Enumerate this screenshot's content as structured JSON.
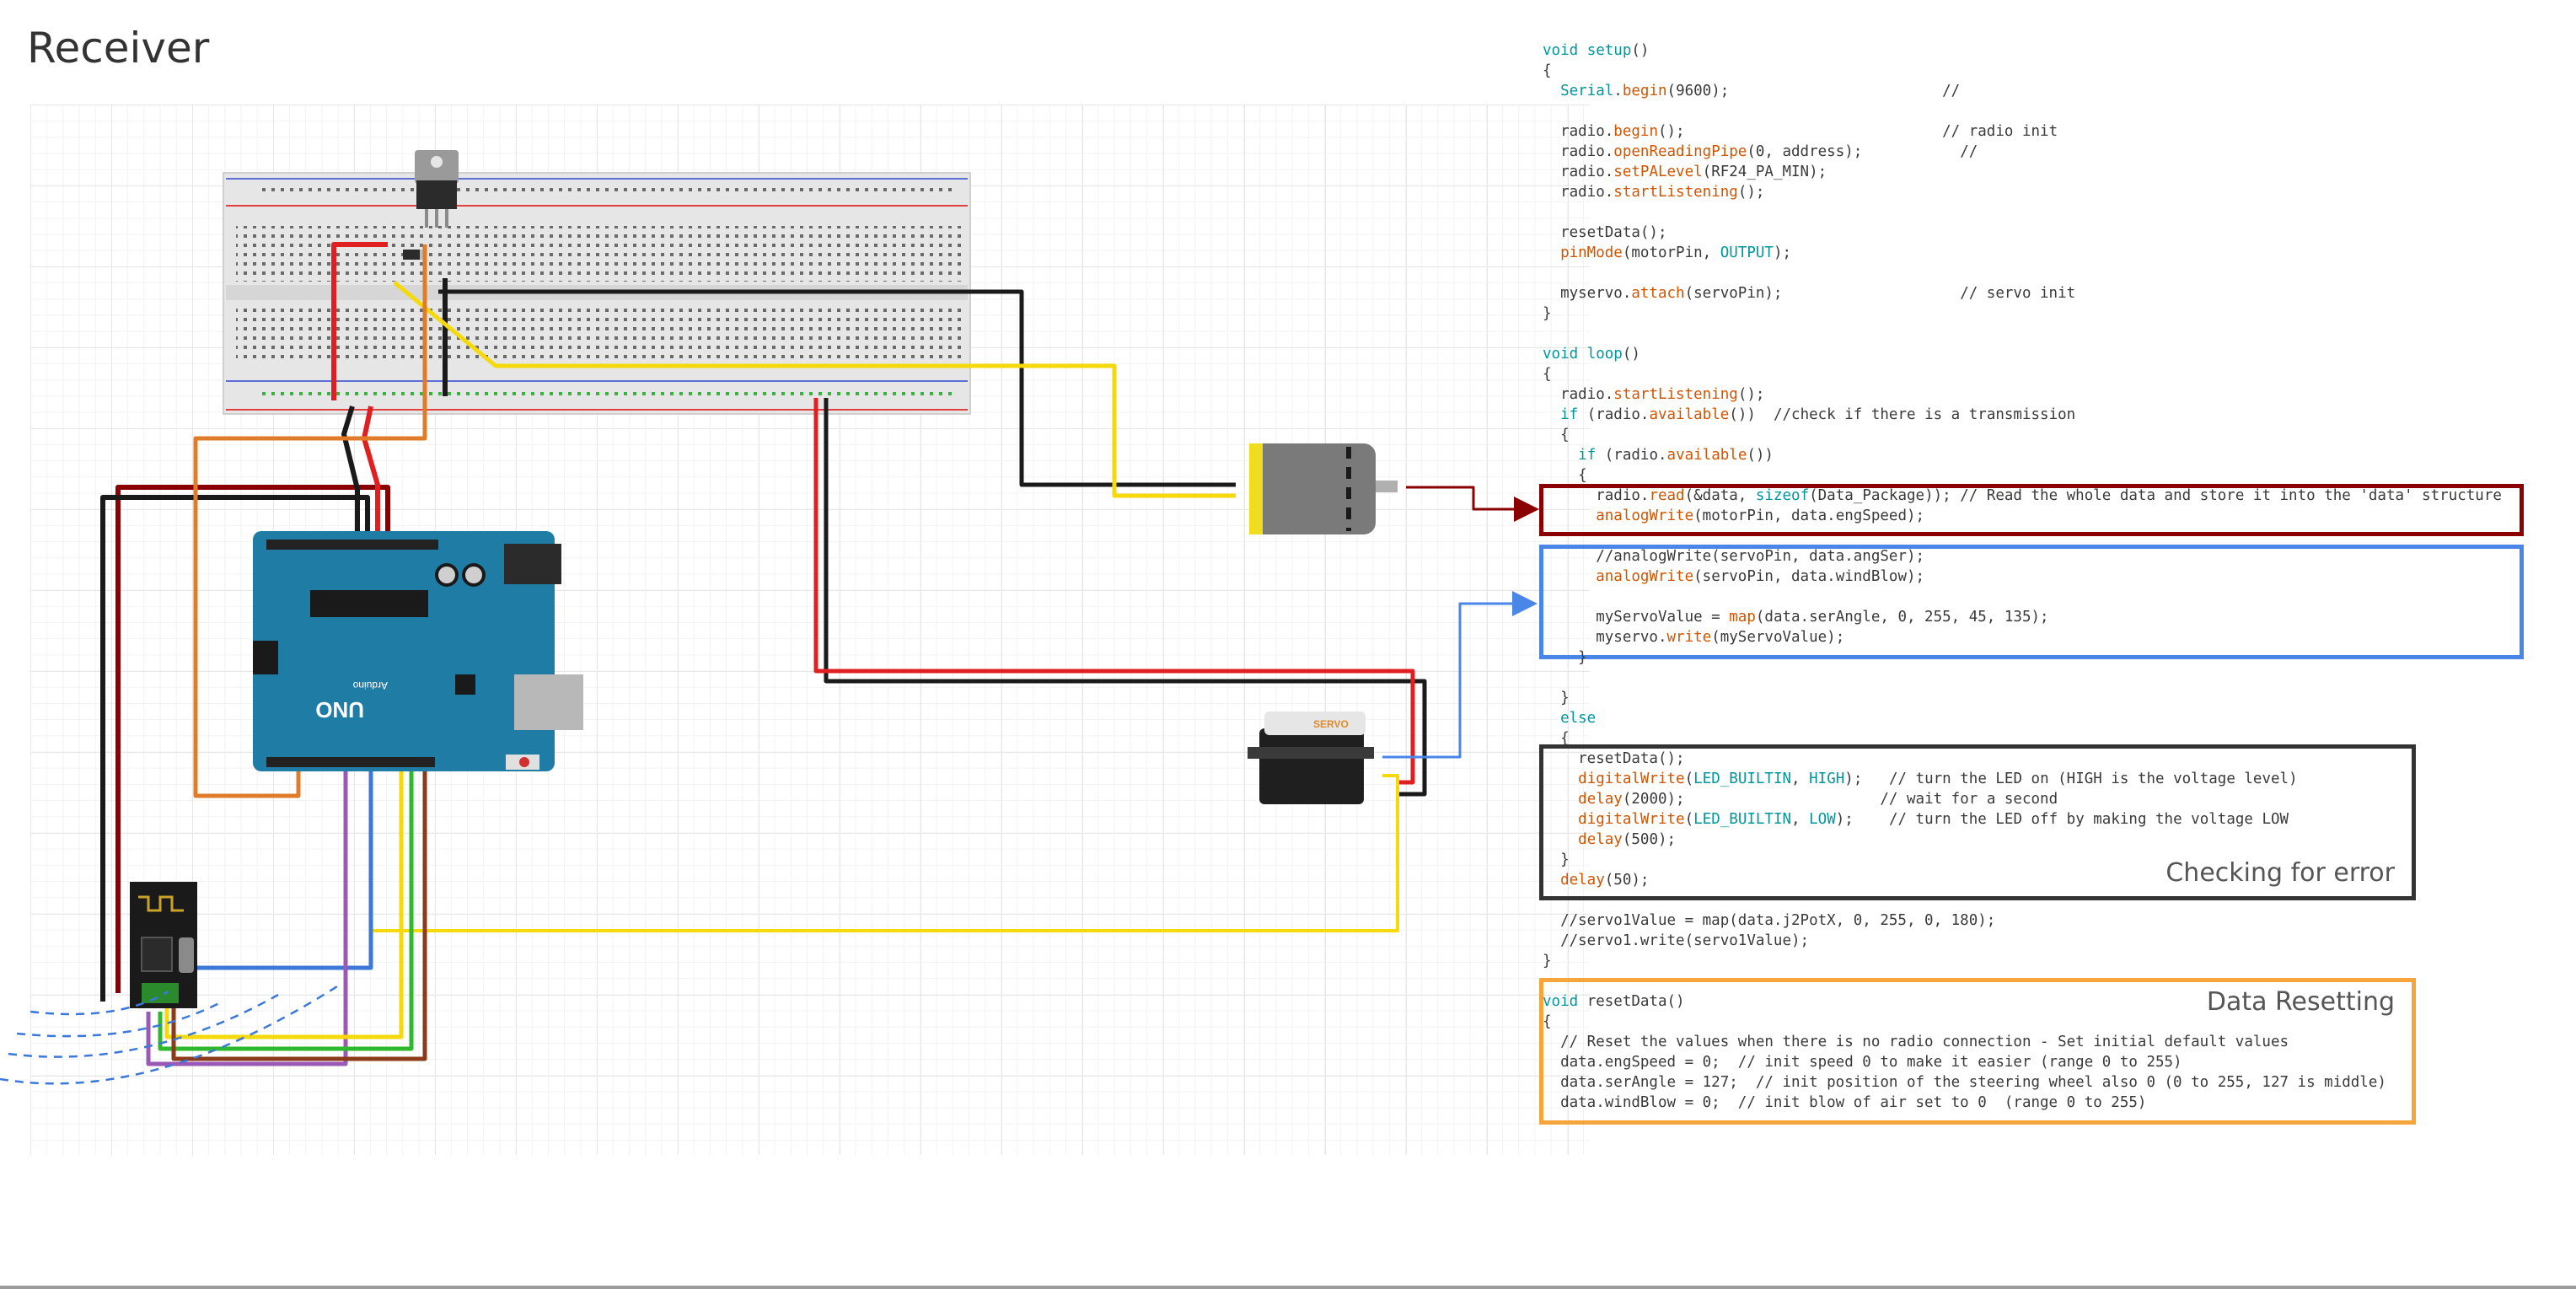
{
  "page_title": "Receiver",
  "colors": {
    "read_box": "#8b0000",
    "servo_box": "#4a86e8",
    "error_box": "#333333",
    "reset_box": "#f6a53c",
    "wire_red": "#e02020",
    "wire_black": "#1a1a1a",
    "wire_yellow": "#f5d90a",
    "wire_orange": "#e07b2a",
    "wire_blue": "#3b78d8",
    "wire_purple": "#9b59b6",
    "wire_green": "#2eb82e",
    "wire_brown": "#8b3a1a",
    "arduino_board": "#1f7ca5",
    "keyword_color": "#00979c",
    "function_color": "#d35400"
  },
  "components": {
    "arduino": {
      "model_label": "UNO",
      "brand_label": "Arduino"
    },
    "servo": {
      "label": "SERVO"
    },
    "breadboard": {},
    "voltage_regulator": {},
    "dc_motor": {},
    "nrf24_module": {}
  },
  "code_lines": [
    [
      [
        "kw",
        "void"
      ],
      [
        "t",
        " "
      ],
      [
        "kw",
        "setup"
      ],
      [
        "t",
        "()"
      ]
    ],
    [
      [
        "t",
        "{"
      ]
    ],
    [
      [
        "t",
        "  "
      ],
      [
        "kw",
        "Serial"
      ],
      [
        "t",
        "."
      ],
      [
        "fn",
        "begin"
      ],
      [
        "t",
        "(9600);                        //"
      ]
    ],
    [
      [
        "t",
        ""
      ]
    ],
    [
      [
        "t",
        "  radio."
      ],
      [
        "fn",
        "begin"
      ],
      [
        "t",
        "();                             // radio init"
      ]
    ],
    [
      [
        "t",
        "  radio."
      ],
      [
        "fn",
        "openReadingPipe"
      ],
      [
        "t",
        "(0, address);           //"
      ]
    ],
    [
      [
        "t",
        "  radio."
      ],
      [
        "fn",
        "setPALevel"
      ],
      [
        "t",
        "(RF24_PA_MIN);"
      ]
    ],
    [
      [
        "t",
        "  radio."
      ],
      [
        "fn",
        "startListening"
      ],
      [
        "t",
        "();"
      ]
    ],
    [
      [
        "t",
        ""
      ]
    ],
    [
      [
        "t",
        "  resetData();"
      ]
    ],
    [
      [
        "t",
        "  "
      ],
      [
        "fn",
        "pinMode"
      ],
      [
        "t",
        "(motorPin, "
      ],
      [
        "kw",
        "OUTPUT"
      ],
      [
        "t",
        ");"
      ]
    ],
    [
      [
        "t",
        ""
      ]
    ],
    [
      [
        "t",
        "  myservo."
      ],
      [
        "fn",
        "attach"
      ],
      [
        "t",
        "(servoPin);                    // servo init"
      ]
    ],
    [
      [
        "t",
        "}"
      ]
    ],
    [
      [
        "t",
        ""
      ]
    ],
    [
      [
        "kw",
        "void"
      ],
      [
        "t",
        " "
      ],
      [
        "kw",
        "loop"
      ],
      [
        "t",
        "()"
      ]
    ],
    [
      [
        "t",
        "{"
      ]
    ],
    [
      [
        "t",
        "  radio."
      ],
      [
        "fn",
        "startListening"
      ],
      [
        "t",
        "();"
      ]
    ],
    [
      [
        "t",
        "  "
      ],
      [
        "kw",
        "if"
      ],
      [
        "t",
        " (radio."
      ],
      [
        "fn",
        "available"
      ],
      [
        "t",
        "())  //check if there is a transmission"
      ]
    ],
    [
      [
        "t",
        "  {"
      ]
    ],
    [
      [
        "t",
        "    "
      ],
      [
        "kw",
        "if"
      ],
      [
        "t",
        " (radio."
      ],
      [
        "fn",
        "available"
      ],
      [
        "t",
        "())"
      ]
    ],
    [
      [
        "t",
        "    {"
      ]
    ],
    [
      [
        "t",
        "      radio."
      ],
      [
        "fn",
        "read"
      ],
      [
        "t",
        "(&data, "
      ],
      [
        "kw",
        "sizeof"
      ],
      [
        "t",
        "(Data_Package)); // Read the whole data and store it into the 'data' structure"
      ]
    ],
    [
      [
        "t",
        "      "
      ],
      [
        "fn",
        "analogWrite"
      ],
      [
        "t",
        "(motorPin, data.engSpeed);"
      ]
    ],
    [
      [
        "t",
        ""
      ]
    ],
    [
      [
        "t",
        "      //analogWrite(servoPin, data.angSer);"
      ]
    ],
    [
      [
        "t",
        "      "
      ],
      [
        "fn",
        "analogWrite"
      ],
      [
        "t",
        "(servoPin, data.windBlow);"
      ]
    ],
    [
      [
        "t",
        ""
      ]
    ],
    [
      [
        "t",
        "      myServoValue = "
      ],
      [
        "fn",
        "map"
      ],
      [
        "t",
        "(data.serAngle, 0, 255, 45, 135);"
      ]
    ],
    [
      [
        "t",
        "      myservo."
      ],
      [
        "fn",
        "write"
      ],
      [
        "t",
        "(myServoValue);"
      ]
    ],
    [
      [
        "t",
        "    }"
      ]
    ],
    [
      [
        "t",
        ""
      ]
    ],
    [
      [
        "t",
        "  }"
      ]
    ],
    [
      [
        "t",
        "  "
      ],
      [
        "kw",
        "else"
      ]
    ],
    [
      [
        "t",
        "  {"
      ]
    ],
    [
      [
        "t",
        "    resetData();"
      ]
    ],
    [
      [
        "t",
        "    "
      ],
      [
        "fn",
        "digitalWrite"
      ],
      [
        "t",
        "("
      ],
      [
        "kw",
        "LED_BUILTIN"
      ],
      [
        "t",
        ", "
      ],
      [
        "kw",
        "HIGH"
      ],
      [
        "t",
        ");   // turn the LED on (HIGH is the voltage level)"
      ]
    ],
    [
      [
        "t",
        "    "
      ],
      [
        "fn",
        "delay"
      ],
      [
        "t",
        "(2000);                      // wait for a second"
      ]
    ],
    [
      [
        "t",
        "    "
      ],
      [
        "fn",
        "digitalWrite"
      ],
      [
        "t",
        "("
      ],
      [
        "kw",
        "LED_BUILTIN"
      ],
      [
        "t",
        ", "
      ],
      [
        "kw",
        "LOW"
      ],
      [
        "t",
        ");    // turn the LED off by making the voltage LOW"
      ]
    ],
    [
      [
        "t",
        "    "
      ],
      [
        "fn",
        "delay"
      ],
      [
        "t",
        "(500);"
      ]
    ],
    [
      [
        "t",
        "  }"
      ]
    ],
    [
      [
        "t",
        "  "
      ],
      [
        "fn",
        "delay"
      ],
      [
        "t",
        "(50);"
      ]
    ],
    [
      [
        "t",
        ""
      ]
    ],
    [
      [
        "t",
        "  //servo1Value = map(data.j2PotX, 0, 255, 0, 180);"
      ]
    ],
    [
      [
        "t",
        "  //servo1.write(servo1Value);"
      ]
    ],
    [
      [
        "t",
        "}"
      ]
    ],
    [
      [
        "t",
        ""
      ]
    ],
    [
      [
        "kw",
        "void"
      ],
      [
        "t",
        " resetData()"
      ]
    ],
    [
      [
        "t",
        "{"
      ]
    ],
    [
      [
        "t",
        "  // Reset the values when there is no radio connection - Set initial default values"
      ]
    ],
    [
      [
        "t",
        "  data.engSpeed = 0;  // init speed 0 to make it easier (range 0 to 255)"
      ]
    ],
    [
      [
        "t",
        "  data.serAngle = 127;  // init position of the steering wheel also 0 (0 to 255, 127 is middle)"
      ]
    ],
    [
      [
        "t",
        "  data.windBlow = 0;  // init blow of air set to 0  (range 0 to 255)"
      ]
    ]
  ],
  "annotations": {
    "error_label": "Checking for error",
    "reset_label": "Data Resetting"
  }
}
